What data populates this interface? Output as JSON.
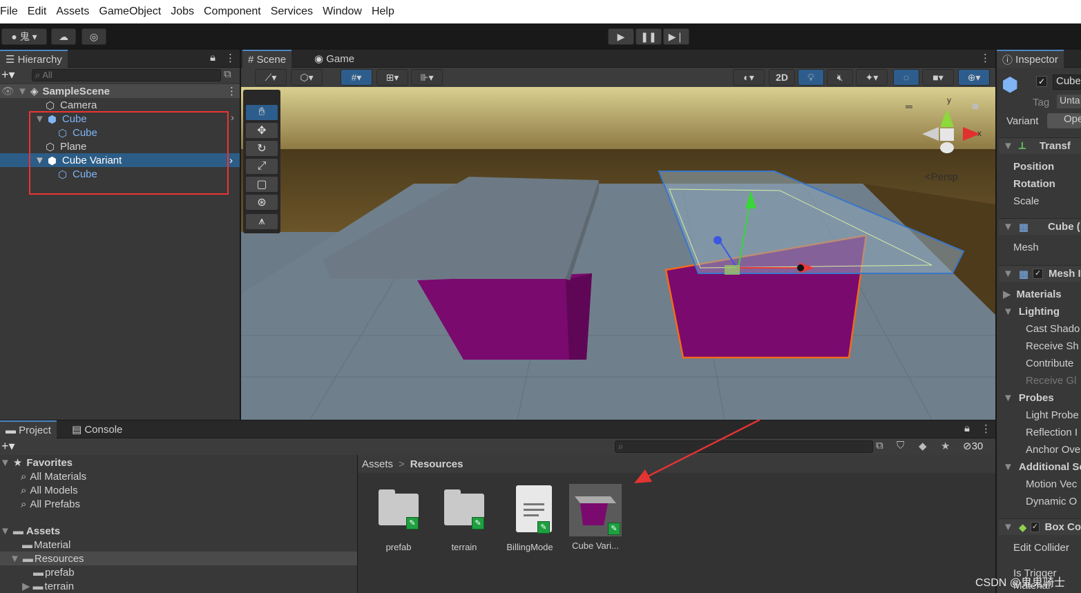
{
  "menu": [
    "File",
    "Edit",
    "Assets",
    "GameObject",
    "Jobs",
    "Component",
    "Services",
    "Window",
    "Help"
  ],
  "toolbar": {
    "account": "鬼"
  },
  "hierarchy": {
    "tab": "Hierarchy",
    "search_placeholder": "All",
    "scene": "SampleScene",
    "items": [
      "Camera",
      "Cube",
      "Cube",
      "Plane",
      "Cube Variant",
      "Cube"
    ]
  },
  "scene": {
    "tab_scene": "Scene",
    "tab_game": "Game",
    "btn_2d": "2D",
    "persp": "Persp",
    "gizmo_y": "y",
    "gizmo_x": "x"
  },
  "inspector": {
    "tab": "Inspector",
    "name": "Cube",
    "tag_label": "Tag",
    "tag_value": "Unta",
    "variant_label": "Variant",
    "variant_btn": "Ope",
    "transform": "Transf",
    "position": "Position",
    "rotation": "Rotation",
    "scale": "Scale",
    "cube_filter": "Cube (",
    "mesh": "Mesh",
    "mesh_renderer": "Mesh I",
    "materials": "Materials",
    "lighting": "Lighting",
    "cast_shadows": "Cast Shado",
    "receive_shadows": "Receive Sh",
    "contribute": "Contribute",
    "receive_gi": "Receive Gl",
    "probes": "Probes",
    "light_probe": "Light Probe",
    "reflection": "Reflection I",
    "anchor": "Anchor Ove",
    "additional": "Additional Se",
    "motion": "Motion Vec",
    "dynamic": "Dynamic O",
    "box_collider": "Box Co",
    "edit_collider": "Edit Collider",
    "is_trigger": "Is Trigger",
    "material": "Material"
  },
  "project": {
    "tab_project": "Project",
    "tab_console": "Console",
    "hidden_count": "30",
    "favorites": "Favorites",
    "fav_items": [
      "All Materials",
      "All Models",
      "All Prefabs"
    ],
    "assets": "Assets",
    "asset_tree": [
      "Material",
      "Resources",
      "prefab",
      "terrain"
    ],
    "breadcrumb_root": "Assets",
    "breadcrumb_sep": ">",
    "breadcrumb_current": "Resources",
    "grid": [
      "prefab",
      "terrain",
      "BillingMode",
      "Cube Vari..."
    ]
  },
  "watermark": "CSDN @鬼鬼骑士",
  "colors": {
    "accent": "#4e86c6",
    "selection": "#2c5d87",
    "highlight_box": "#e33333",
    "arrow": "#e33333"
  }
}
